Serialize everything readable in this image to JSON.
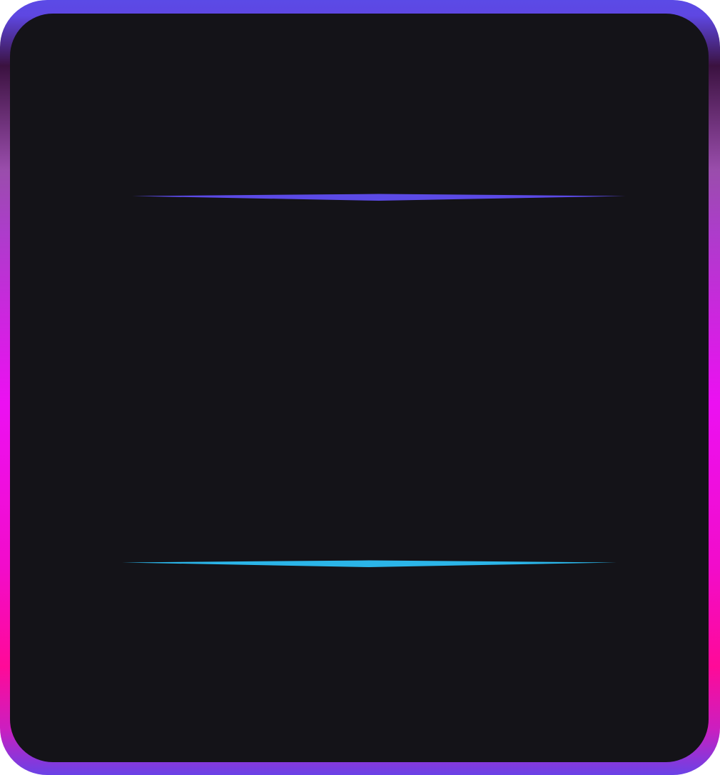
{
  "theme": {
    "panel_color": "#141318",
    "frame_gradient": [
      {
        "stop": 0.0,
        "color": "#5b4ae6"
      },
      {
        "stop": 0.02,
        "color": "#5e47e2"
      },
      {
        "stop": 0.085,
        "color": "#3b1240"
      },
      {
        "stop": 0.22,
        "color": "#9a4dac"
      },
      {
        "stop": 0.3,
        "color": "#ad3ccb"
      },
      {
        "stop": 0.52,
        "color": "#ec10f2"
      },
      {
        "stop": 0.73,
        "color": "#f20ccb"
      },
      {
        "stop": 0.86,
        "color": "#ff0a98"
      },
      {
        "stop": 0.94,
        "color": "#cc1ebf"
      },
      {
        "stop": 1.0,
        "color": "#6a42e6"
      }
    ],
    "top_divider_color": "#5b4ae6",
    "bottom_divider_color": "#2bb5e8"
  }
}
